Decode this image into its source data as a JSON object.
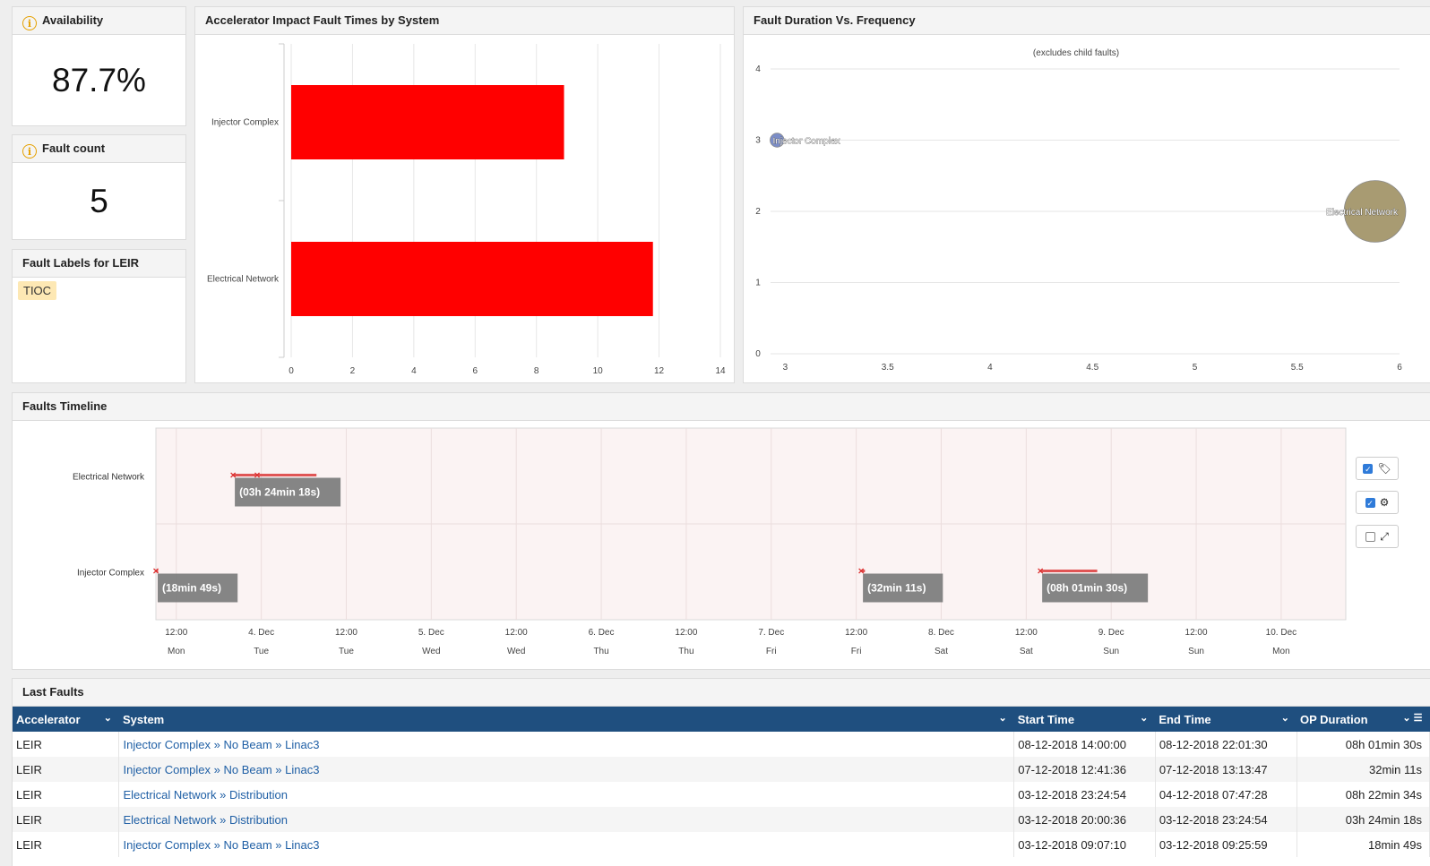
{
  "availability": {
    "title": "Availability",
    "value": "87.7%"
  },
  "fault_count": {
    "title": "Fault count",
    "value": "5"
  },
  "fault_labels": {
    "title": "Fault Labels for LEIR",
    "tags": [
      "TIOC"
    ]
  },
  "chart_data": [
    {
      "type": "bar",
      "title": "Accelerator Impact Fault Times by System",
      "categories": [
        "Injector Complex",
        "Electrical Network"
      ],
      "values": [
        8.9,
        11.8
      ],
      "xlim": [
        0,
        14
      ],
      "ticks": [
        "0",
        "2",
        "4",
        "6",
        "8",
        "10",
        "12",
        "14"
      ],
      "color": "#ff0000",
      "grid": true
    },
    {
      "type": "scatter",
      "title": "Fault Duration Vs. Frequency",
      "subtitle": "(excludes child faults)",
      "series": [
        {
          "name": "Injector Complex",
          "x": 2.96,
          "y": 3,
          "size": 1,
          "color": "#7b8dc8"
        },
        {
          "name": "Electrical Network",
          "x": 5.88,
          "y": 2,
          "size": 8,
          "color": "#a89b72"
        }
      ],
      "xlim": [
        2.95,
        6
      ],
      "ylim": [
        0,
        4
      ],
      "xticks": [
        "3",
        "3.5",
        "4",
        "4.5",
        "5",
        "5.5",
        "6"
      ],
      "yticks": [
        "0",
        "1",
        "2",
        "3",
        "4"
      ],
      "grid": true
    }
  ],
  "timeline": {
    "title": "Faults Timeline",
    "rows": [
      "Electrical Network",
      "Injector Complex"
    ],
    "ticks": [
      {
        "top": "12:00",
        "bottom": "Mon"
      },
      {
        "top": "4. Dec",
        "bottom": "Tue"
      },
      {
        "top": "12:00",
        "bottom": "Tue"
      },
      {
        "top": "5. Dec",
        "bottom": "Wed"
      },
      {
        "top": "12:00",
        "bottom": "Wed"
      },
      {
        "top": "6. Dec",
        "bottom": "Thu"
      },
      {
        "top": "12:00",
        "bottom": "Thu"
      },
      {
        "top": "7. Dec",
        "bottom": "Fri"
      },
      {
        "top": "12:00",
        "bottom": "Fri"
      },
      {
        "top": "8. Dec",
        "bottom": "Sat"
      },
      {
        "top": "12:00",
        "bottom": "Sat"
      },
      {
        "top": "9. Dec",
        "bottom": "Sun"
      },
      {
        "top": "12:00",
        "bottom": "Sun"
      },
      {
        "top": "10. Dec",
        "bottom": "Mon"
      }
    ],
    "faults": [
      {
        "row": "Electrical Network",
        "start": "03-12-2018 20:00:36",
        "end": "03-12-2018 23:24:54",
        "label": "(03h 24min 18s)"
      },
      {
        "row": "Electrical Network",
        "start": "03-12-2018 23:24:54",
        "end": "04-12-2018 07:47:28",
        "label": ""
      },
      {
        "row": "Injector Complex",
        "start": "03-12-2018 09:07:10",
        "end": "03-12-2018 09:25:59",
        "label": "(18min 49s)"
      },
      {
        "row": "Injector Complex",
        "start": "07-12-2018 12:41:36",
        "end": "07-12-2018 13:13:47",
        "label": "(32min 11s)"
      },
      {
        "row": "Injector Complex",
        "start": "08-12-2018 14:00:00",
        "end": "08-12-2018 22:01:30",
        "label": "(08h 01min 30s)"
      }
    ],
    "controls": [
      {
        "icon": "tags-icon",
        "checked": true,
        "glyph": "🏷"
      },
      {
        "icon": "hierarchy-icon",
        "checked": true,
        "glyph": "⚙"
      },
      {
        "icon": "expand-icon",
        "checked": false,
        "glyph": "⤢"
      }
    ]
  },
  "last_faults": {
    "title": "Last Faults",
    "columns": [
      "Accelerator",
      "System",
      "Start Time",
      "End Time",
      "OP Duration"
    ],
    "rows": [
      [
        "LEIR",
        "Injector Complex » No Beam » Linac3",
        "08-12-2018 14:00:00",
        "08-12-2018 22:01:30",
        "08h 01min 30s"
      ],
      [
        "LEIR",
        "Injector Complex » No Beam » Linac3",
        "07-12-2018 12:41:36",
        "07-12-2018 13:13:47",
        "32min 11s"
      ],
      [
        "LEIR",
        "Electrical Network » Distribution",
        "03-12-2018 23:24:54",
        "04-12-2018 07:47:28",
        "08h 22min 34s"
      ],
      [
        "LEIR",
        "Electrical Network » Distribution",
        "03-12-2018 20:00:36",
        "03-12-2018 23:24:54",
        "03h 24min 18s"
      ],
      [
        "LEIR",
        "Injector Complex » No Beam » Linac3",
        "03-12-2018 09:07:10",
        "03-12-2018 09:25:59",
        "18min 49s"
      ]
    ]
  }
}
